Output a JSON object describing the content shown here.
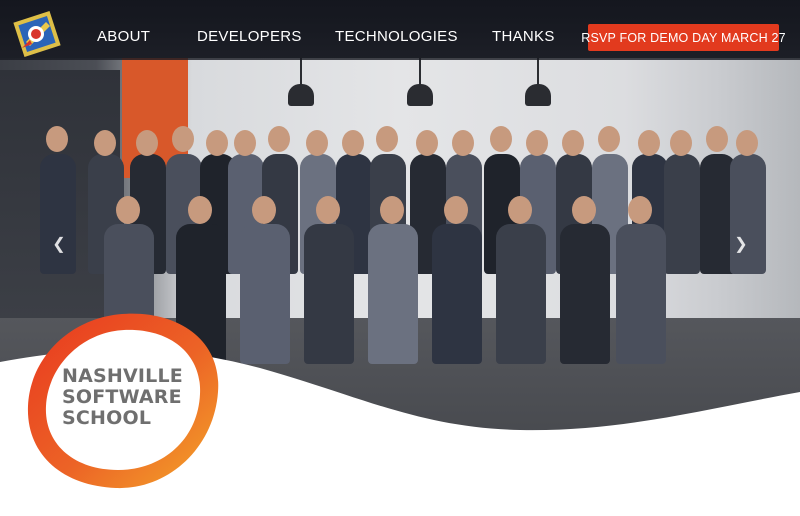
{
  "nav": {
    "brand_icon": "nss-rocket-icon",
    "links": [
      "ABOUT",
      "DEVELOPERS",
      "TECHNOLOGIES",
      "THANKS"
    ],
    "rsvp_label": "RSVP FOR DEMO DAY MARCH 27"
  },
  "hero": {
    "image_alt": "team-group-photo",
    "prev_icon": "chevron-left-icon",
    "next_icon": "chevron-right-icon"
  },
  "logo": {
    "lines": [
      "NASHVILLE",
      "SOFTWARE",
      "SCHOOL"
    ]
  },
  "colors": {
    "navbar": "#1a1c24",
    "rsvp_button": "#e23a1e",
    "logo_ring_start": "#e8381f",
    "logo_ring_end": "#f4a62a",
    "logo_text": "#6f6f6f"
  }
}
